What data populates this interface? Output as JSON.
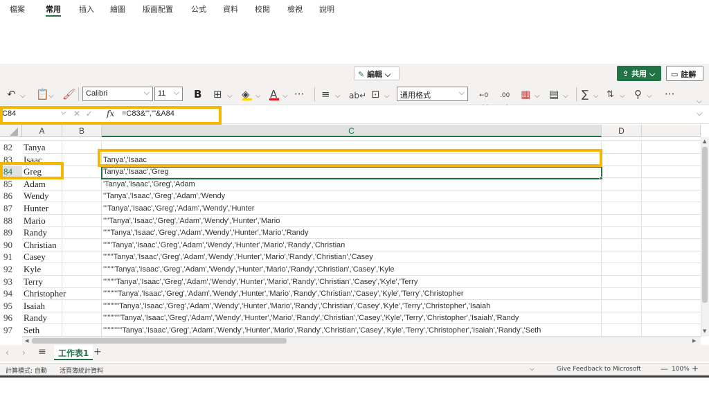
{
  "ribbon": {
    "tabs": [
      "檔案",
      "常用",
      "插入",
      "繪圖",
      "版面配置",
      "公式",
      "資料",
      "校閱",
      "檢視",
      "說明"
    ],
    "active_tab": "常用",
    "edit_label": "編輯",
    "share_label": "共用",
    "comment_label": "註解"
  },
  "toolbar": {
    "font_name": "Calibri",
    "font_size": "11",
    "bold": "B",
    "number_format": "通用格式",
    "more": "···",
    "accent_colors": {
      "font_color": "#e81123",
      "fill_color": "#ffd400"
    }
  },
  "formula_bar": {
    "name_box": "C84",
    "fx": "fx",
    "formula": "=C83&\"','\"&A84"
  },
  "grid": {
    "columns": [
      "A",
      "B",
      "C",
      "D"
    ],
    "selected_column": "C",
    "rows": [
      {
        "num": "82",
        "a": "Tanya",
        "c": ""
      },
      {
        "num": "83",
        "a": "Isaac",
        "c": "Tanya','Isaac"
      },
      {
        "num": "84",
        "a": "Greg",
        "c": "Tanya','Isaac','Greg"
      },
      {
        "num": "85",
        "a": "Adam",
        "c": "'Tanya','Isaac','Greg','Adam"
      },
      {
        "num": "86",
        "a": "Wendy",
        "c": "''Tanya','Isaac','Greg','Adam','Wendy"
      },
      {
        "num": "87",
        "a": "Hunter",
        "c": "'''Tanya','Isaac','Greg','Adam','Wendy','Hunter"
      },
      {
        "num": "88",
        "a": "Mario",
        "c": "''''Tanya','Isaac','Greg','Adam','Wendy','Hunter','Mario"
      },
      {
        "num": "89",
        "a": "Randy",
        "c": "'''''Tanya','Isaac','Greg','Adam','Wendy','Hunter','Mario','Randy"
      },
      {
        "num": "90",
        "a": "Christian",
        "c": "''''''Tanya','Isaac','Greg','Adam','Wendy','Hunter','Mario','Randy','Christian"
      },
      {
        "num": "91",
        "a": "Casey",
        "c": "'''''''Tanya','Isaac','Greg','Adam','Wendy','Hunter','Mario','Randy','Christian','Casey"
      },
      {
        "num": "92",
        "a": "Kyle",
        "c": "''''''''Tanya','Isaac','Greg','Adam','Wendy','Hunter','Mario','Randy','Christian','Casey','Kyle"
      },
      {
        "num": "93",
        "a": "Terry",
        "c": "'''''''''Tanya','Isaac','Greg','Adam','Wendy','Hunter','Mario','Randy','Christian','Casey','Kyle','Terry"
      },
      {
        "num": "94",
        "a": "Christopher",
        "c": "''''''''''Tanya','Isaac','Greg','Adam','Wendy','Hunter','Mario','Randy','Christian','Casey','Kyle','Terry','Christopher"
      },
      {
        "num": "95",
        "a": "Isaiah",
        "c": "'''''''''''Tanya','Isaac','Greg','Adam','Wendy','Hunter','Mario','Randy','Christian','Casey','Kyle','Terry','Christopher','Isaiah"
      },
      {
        "num": "96",
        "a": "Randy",
        "c": "''''''''''''Tanya','Isaac','Greg','Adam','Wendy','Hunter','Mario','Randy','Christian','Casey','Kyle','Terry','Christopher','Isaiah','Randy"
      },
      {
        "num": "97",
        "a": "Seth",
        "c": "'''''''''''''Tanya','Isaac','Greg','Adam','Wendy','Hunter','Mario','Randy','Christian','Casey','Kyle','Terry','Christopher','Isaiah','Randy','Seth"
      }
    ],
    "selected_row": "84"
  },
  "sheets": {
    "active": "工作表1"
  },
  "status": {
    "calc_mode": "計算模式: 自動",
    "workbook_stats": "活頁簿統計資料",
    "feedback": "Give Feedback to Microsoft",
    "zoom": "100%"
  },
  "colors": {
    "accent": "#217346",
    "highlight": "#f5b800"
  }
}
